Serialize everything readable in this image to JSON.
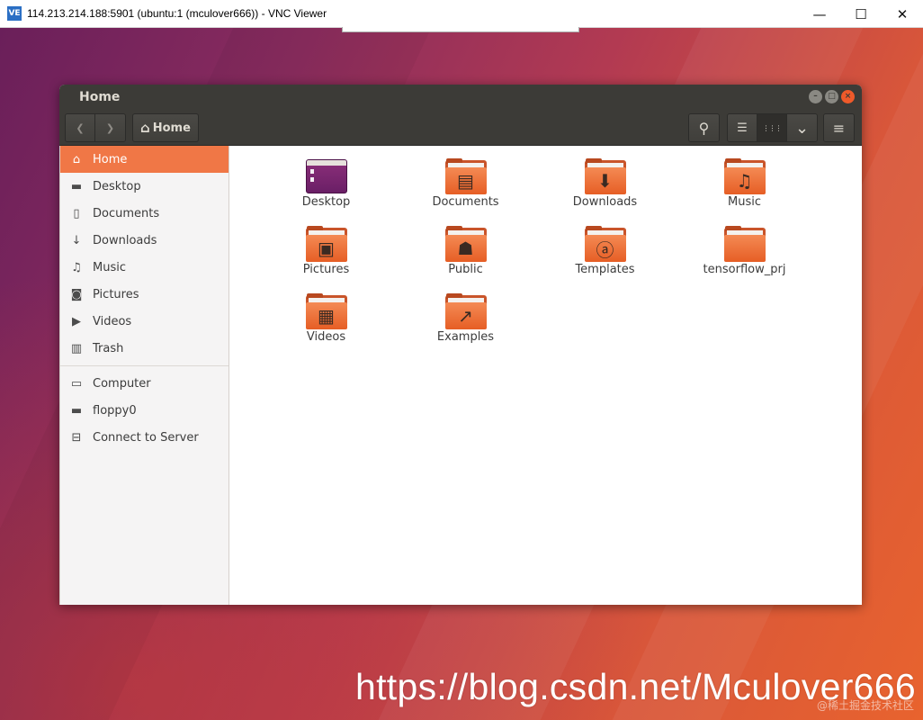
{
  "vnc": {
    "title": "114.213.214.188:5901 (ubuntu:1 (mculover666)) - VNC Viewer",
    "logo": "VE",
    "minimize": "—",
    "maximize": "☐",
    "close": "✕"
  },
  "window": {
    "title": "Home",
    "controls": {
      "minimize": "–",
      "maximize": "□",
      "close": "×"
    }
  },
  "toolbar": {
    "back": "❮",
    "forward": "❯",
    "path_icon": "⌂",
    "path_label": "Home",
    "search": "⚲",
    "list_view": "☰",
    "grid_view": "⋮⋮⋮",
    "view_options": "⌄",
    "menu": "≡"
  },
  "sidebar": {
    "places": [
      {
        "label": "Home",
        "icon": "home-icon",
        "glyph": "⌂"
      },
      {
        "label": "Desktop",
        "icon": "desktop-icon",
        "glyph": "▬"
      },
      {
        "label": "Documents",
        "icon": "documents-icon",
        "glyph": "▯"
      },
      {
        "label": "Downloads",
        "icon": "downloads-icon",
        "glyph": "↓"
      },
      {
        "label": "Music",
        "icon": "music-icon",
        "glyph": "♫"
      },
      {
        "label": "Pictures",
        "icon": "camera-icon",
        "glyph": "◙"
      },
      {
        "label": "Videos",
        "icon": "video-icon",
        "glyph": "▶"
      },
      {
        "label": "Trash",
        "icon": "trash-icon",
        "glyph": "▥"
      }
    ],
    "devices": [
      {
        "label": "Computer",
        "icon": "computer-icon",
        "glyph": "▭"
      },
      {
        "label": "floppy0",
        "icon": "drive-icon",
        "glyph": "▬"
      },
      {
        "label": "Connect to Server",
        "icon": "server-icon",
        "glyph": "⊟"
      }
    ]
  },
  "files": [
    {
      "label": "Desktop",
      "icon": "desktop-folder-icon",
      "emblem": ""
    },
    {
      "label": "Documents",
      "icon": "documents-folder-icon",
      "emblem": "▤"
    },
    {
      "label": "Downloads",
      "icon": "downloads-folder-icon",
      "emblem": "⬇"
    },
    {
      "label": "Music",
      "icon": "music-folder-icon",
      "emblem": "♫"
    },
    {
      "label": "Pictures",
      "icon": "pictures-folder-icon",
      "emblem": "▣"
    },
    {
      "label": "Public",
      "icon": "public-folder-icon",
      "emblem": "☗"
    },
    {
      "label": "Templates",
      "icon": "templates-folder-icon",
      "emblem": "ⓐ"
    },
    {
      "label": "tensorflow_prj",
      "icon": "folder-icon",
      "emblem": ""
    },
    {
      "label": "Videos",
      "icon": "videos-folder-icon",
      "emblem": "▦"
    },
    {
      "label": "Examples",
      "icon": "examples-folder-icon",
      "emblem": "↗"
    }
  ],
  "watermark": "https://blog.csdn.net/Mculover666",
  "watermark_small": "@稀土掘金技术社区"
}
